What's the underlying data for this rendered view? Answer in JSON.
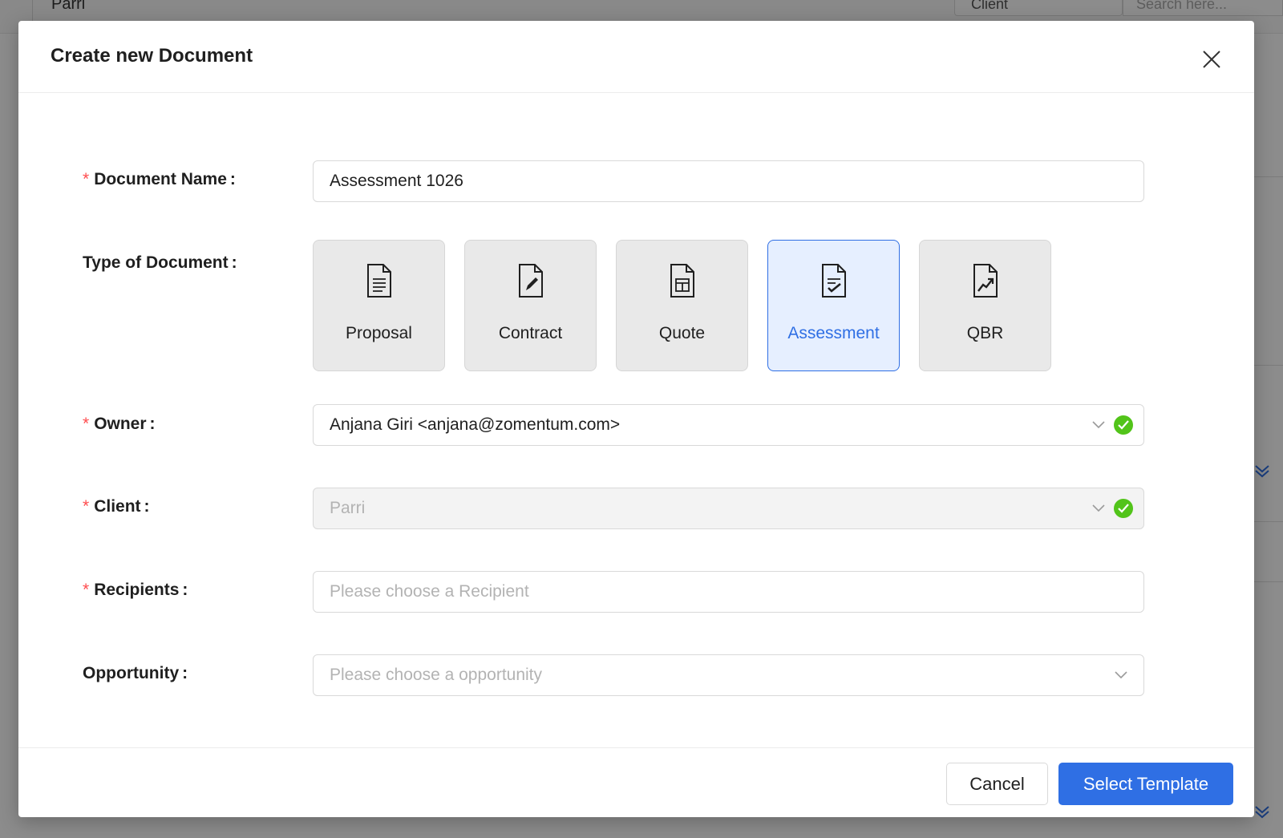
{
  "background": {
    "title": "Parri",
    "select_value": "Client",
    "search_placeholder": "Search here..."
  },
  "modal": {
    "title": "Create new Document",
    "close_icon": "close-icon"
  },
  "form": {
    "document_name": {
      "label": "Document Name",
      "required": true,
      "value": "Assessment 1026"
    },
    "type_of_document": {
      "label": "Type of Document",
      "options": [
        {
          "label": "Proposal",
          "icon": "document-lines-icon",
          "selected": false
        },
        {
          "label": "Contract",
          "icon": "document-pen-icon",
          "selected": false
        },
        {
          "label": "Quote",
          "icon": "document-table-icon",
          "selected": false
        },
        {
          "label": "Assessment",
          "icon": "document-check-icon",
          "selected": true
        },
        {
          "label": "QBR",
          "icon": "document-chart-icon",
          "selected": false
        }
      ]
    },
    "owner": {
      "label": "Owner",
      "required": true,
      "value": "Anjana Giri <anjana@zomentum.com>"
    },
    "client": {
      "label": "Client",
      "required": true,
      "value": "Parri"
    },
    "recipients": {
      "label": "Recipients",
      "required": true,
      "placeholder": "Please choose a Recipient"
    },
    "opportunity": {
      "label": "Opportunity",
      "required": false,
      "placeholder": "Please choose a opportunity"
    }
  },
  "footer": {
    "cancel_label": "Cancel",
    "primary_label": "Select Template"
  },
  "colors": {
    "primary": "#2f6fe4",
    "required": "#ff4d4f",
    "success": "#52c41a",
    "selected_bg": "#e6efff"
  }
}
